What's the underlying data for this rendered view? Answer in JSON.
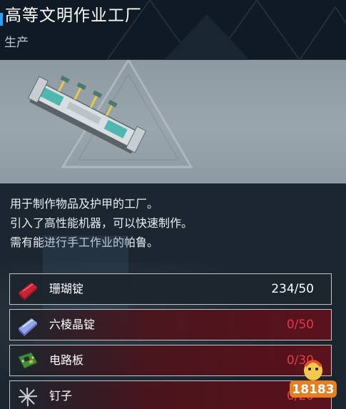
{
  "header": {
    "title": "高等文明作业工厂",
    "subtitle": "生产"
  },
  "description": {
    "lines": [
      "用于制作物品及护甲的工厂。",
      "引入了高性能机器，可以快速制作。",
      "需有能进行手工作业的帕鲁。"
    ]
  },
  "materials": [
    {
      "name": "珊瑚锭",
      "count": "234/50",
      "icon": "coral-ingot-icon",
      "sufficient": true
    },
    {
      "name": "六棱晶锭",
      "count": "0/50",
      "icon": "hexolite-ingot-icon",
      "sufficient": false
    },
    {
      "name": "电路板",
      "count": "0/30",
      "icon": "circuit-board-icon",
      "sufficient": false
    },
    {
      "name": "钉子",
      "count": "0/20",
      "icon": "nails-icon",
      "sufficient": false
    }
  ],
  "watermark": {
    "text": "18183"
  },
  "colors": {
    "accent": "#2aa0ff",
    "insufficient": "#e5394a",
    "sufficient": "#ffffff"
  }
}
